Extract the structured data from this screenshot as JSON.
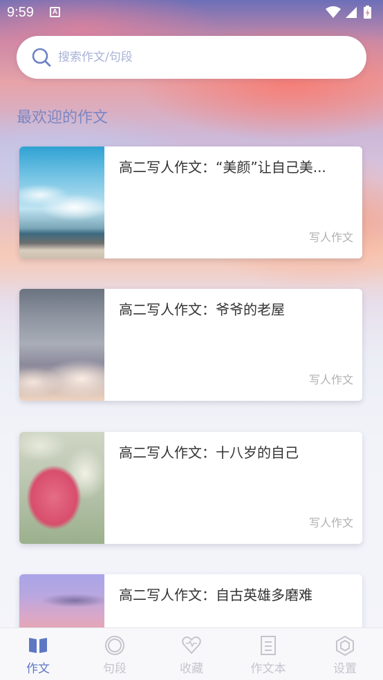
{
  "status_bar": {
    "time": "9:59",
    "notification_icon": "A",
    "icons": [
      "wifi-icon",
      "signal-icon",
      "battery-charging-icon"
    ]
  },
  "search": {
    "placeholder": "搜索作文/句段",
    "value": "",
    "icon": "search-icon"
  },
  "section_title": "最欢迎的作文",
  "articles": [
    {
      "title": "高二写人作文：“美颜”让自己美...",
      "tag": "写人作文",
      "image": "seashore-clouds"
    },
    {
      "title": "高二写人作文：爷爷的老屋",
      "tag": "写人作文",
      "image": "sea-of-clouds"
    },
    {
      "title": "高二写人作文：十八岁的自己",
      "tag": "写人作文",
      "image": "pink-tulip"
    },
    {
      "title": "高二写人作文：自古英雄多磨难",
      "tag": "",
      "image": "purple-sky"
    }
  ],
  "bottom_nav": {
    "active_color": "#5d77c2",
    "inactive_color": "#c4c4cc",
    "items": [
      {
        "label": "作文",
        "icon": "book-icon",
        "active": true
      },
      {
        "label": "句段",
        "icon": "circle-icon",
        "active": false
      },
      {
        "label": "收藏",
        "icon": "heart-icon",
        "active": false
      },
      {
        "label": "作文本",
        "icon": "notebook-icon",
        "active": false
      },
      {
        "label": "设置",
        "icon": "hexagon-icon",
        "active": false
      }
    ]
  }
}
